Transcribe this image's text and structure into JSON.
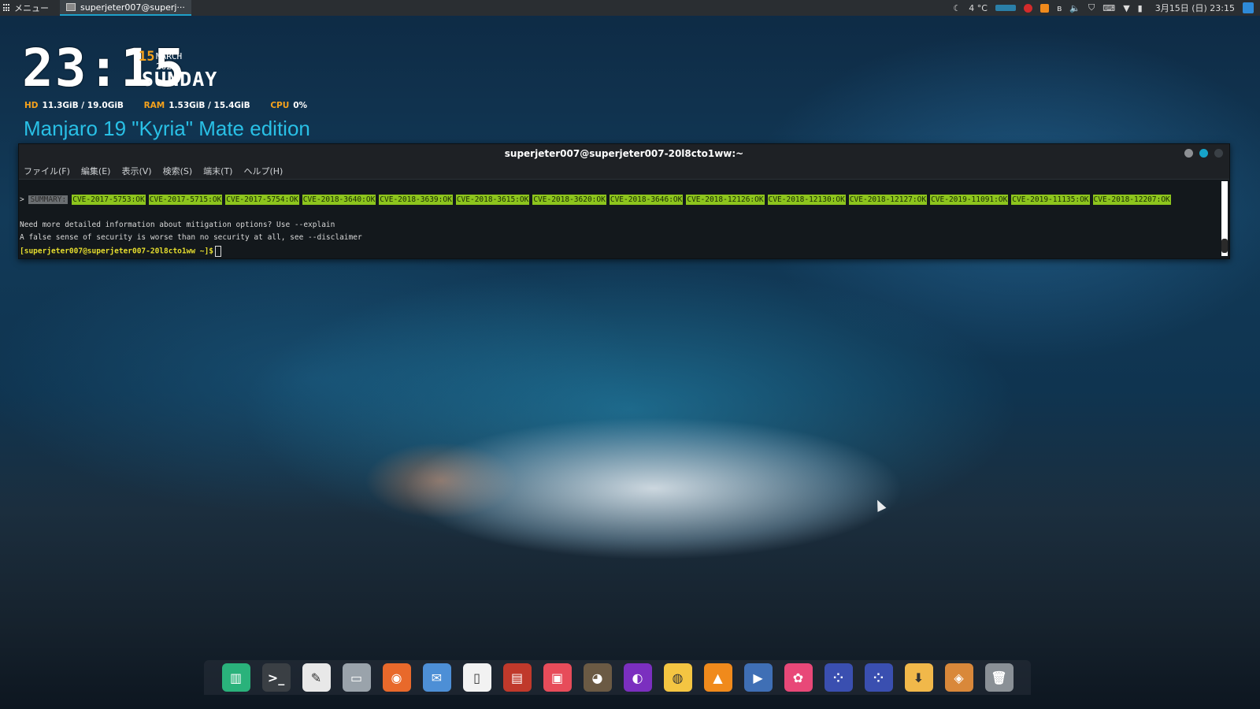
{
  "topbar": {
    "menu_label": "メニュー",
    "task_label": "superjeter007@superj···",
    "weather": "4 °C",
    "datetime": "3月15日 (日) 23:15"
  },
  "conky": {
    "time": "23:15",
    "day_num": "15",
    "month_year": "MARCH 2020",
    "weekday": "SUNDAY",
    "hd_label": "HD",
    "hd_value": "11.3GiB / 19.0GiB",
    "ram_label": "RAM",
    "ram_value": "1.53GiB / 15.4GiB",
    "cpu_label": "CPU",
    "cpu_value": "0%",
    "edition": "Manjaro 19 \"Kyria\" Mate edition"
  },
  "terminal": {
    "title": "superjeter007@superjeter007-20l8cto1ww:~",
    "menu": [
      "ファイル(F)",
      "編集(E)",
      "表示(V)",
      "検索(S)",
      "端末(T)",
      "ヘルプ(H)"
    ],
    "summary_prefix": ">",
    "summary_label": "SUMMARY:",
    "cves": [
      "CVE-2017-5753:OK",
      "CVE-2017-5715:OK",
      "CVE-2017-5754:OK",
      "CVE-2018-3640:OK",
      "CVE-2018-3639:OK",
      "CVE-2018-3615:OK",
      "CVE-2018-3620:OK",
      "CVE-2018-3646:OK",
      "CVE-2018-12126:OK",
      "CVE-2018-12130:OK",
      "CVE-2018-12127:OK",
      "CVE-2019-11091:OK",
      "CVE-2019-11135:OK",
      "CVE-2018-12207:OK"
    ],
    "line2": "Need more detailed information about mitigation options? Use --explain",
    "line3": "A false sense of security is worse than no security at all, see --disclaimer",
    "prompt": "[superjeter007@superjeter007-20l8cto1ww ~]$"
  },
  "dock": {
    "items": [
      {
        "name": "manjaro-settings-icon",
        "color": "#2ab27b",
        "glyph": "▥"
      },
      {
        "name": "terminal-icon",
        "color": "#3a3f44",
        "glyph": ">_"
      },
      {
        "name": "text-editor-icon",
        "color": "#e8e8e8",
        "glyph": "✎"
      },
      {
        "name": "file-manager-icon",
        "color": "#9aa3ab",
        "glyph": "▭"
      },
      {
        "name": "firefox-icon",
        "color": "#e8692b",
        "glyph": "◉"
      },
      {
        "name": "mail-client-icon",
        "color": "#4d8fd6",
        "glyph": "✉"
      },
      {
        "name": "document-icon",
        "color": "#f2f2f2",
        "glyph": "▯"
      },
      {
        "name": "document-viewer-icon",
        "color": "#c0392b",
        "glyph": "▤"
      },
      {
        "name": "screenshot-icon",
        "color": "#e74c5a",
        "glyph": "▣"
      },
      {
        "name": "gimp-icon",
        "color": "#6b5a44",
        "glyph": "◕"
      },
      {
        "name": "kdenlive-icon",
        "color": "#7b2fbf",
        "glyph": "◐"
      },
      {
        "name": "color-palette-icon",
        "color": "#f4c542",
        "glyph": "◍"
      },
      {
        "name": "vlc-icon",
        "color": "#f08a1c",
        "glyph": "▲"
      },
      {
        "name": "media-player-icon",
        "color": "#3f6fb5",
        "glyph": "▶"
      },
      {
        "name": "software-center-icon",
        "color": "#e84878",
        "glyph": "✿"
      },
      {
        "name": "app-blue-dots-icon",
        "color": "#3a4fb0",
        "glyph": "⁘"
      },
      {
        "name": "app-blue-dots-2-icon",
        "color": "#3a4fb0",
        "glyph": "⁘"
      },
      {
        "name": "downloader-icon",
        "color": "#f1b84a",
        "glyph": "⬇"
      },
      {
        "name": "package-icon",
        "color": "#d9883a",
        "glyph": "◈"
      },
      {
        "name": "trash-icon",
        "color": "#8a9096",
        "glyph": "🗑"
      }
    ]
  }
}
